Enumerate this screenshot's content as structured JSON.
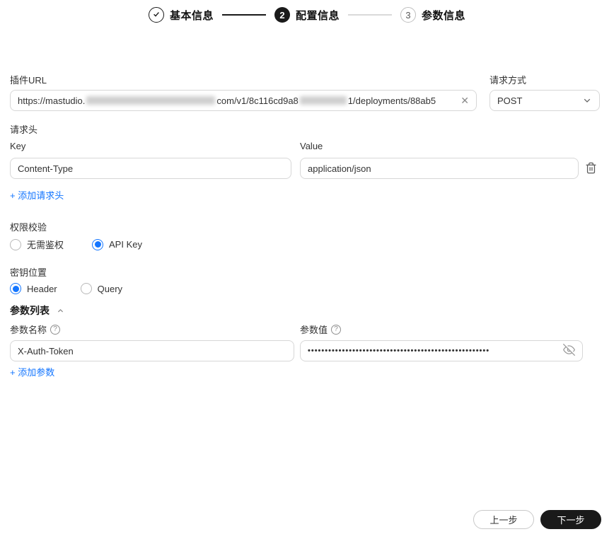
{
  "stepper": {
    "steps": [
      {
        "label": "基本信息",
        "number": "",
        "state": "done"
      },
      {
        "label": "配置信息",
        "number": "2",
        "state": "current"
      },
      {
        "label": "参数信息",
        "number": "3",
        "state": "upcoming"
      }
    ]
  },
  "plugin_url": {
    "label": "插件URL",
    "value_part1": "https://mastudio.",
    "value_part2": "com/v1/8c116cd9a8",
    "value_part3": "1/deployments/88ab5"
  },
  "request_method": {
    "label": "请求方式",
    "value": "POST"
  },
  "request_headers": {
    "title": "请求头",
    "key_label": "Key",
    "value_label": "Value",
    "row": {
      "key": "Content-Type",
      "value": "application/json"
    },
    "add_link": "+ 添加请求头"
  },
  "auth_check": {
    "label": "权限校验",
    "options": [
      {
        "label": "无需鉴权",
        "selected": false
      },
      {
        "label": "API Key",
        "selected": true
      }
    ]
  },
  "key_location": {
    "label": "密钥位置",
    "options": [
      {
        "label": "Header",
        "selected": true
      },
      {
        "label": "Query",
        "selected": false
      }
    ]
  },
  "param_list": {
    "title": "参数列表",
    "name_label": "参数名称",
    "value_label": "参数值",
    "row": {
      "name": "X-Auth-Token",
      "masked_value": "•••••••••••••••••••••••••••••••••••••••••••••••••••••"
    },
    "add_link": "+ 添加参数"
  },
  "footer": {
    "prev_label": "上一步",
    "next_label": "下一步"
  },
  "icons": {
    "clear": "✕",
    "help": "?"
  },
  "colors": {
    "accent_blue": "#1476ff",
    "dark": "#1a1a1a",
    "border": "#d7d7d7"
  }
}
